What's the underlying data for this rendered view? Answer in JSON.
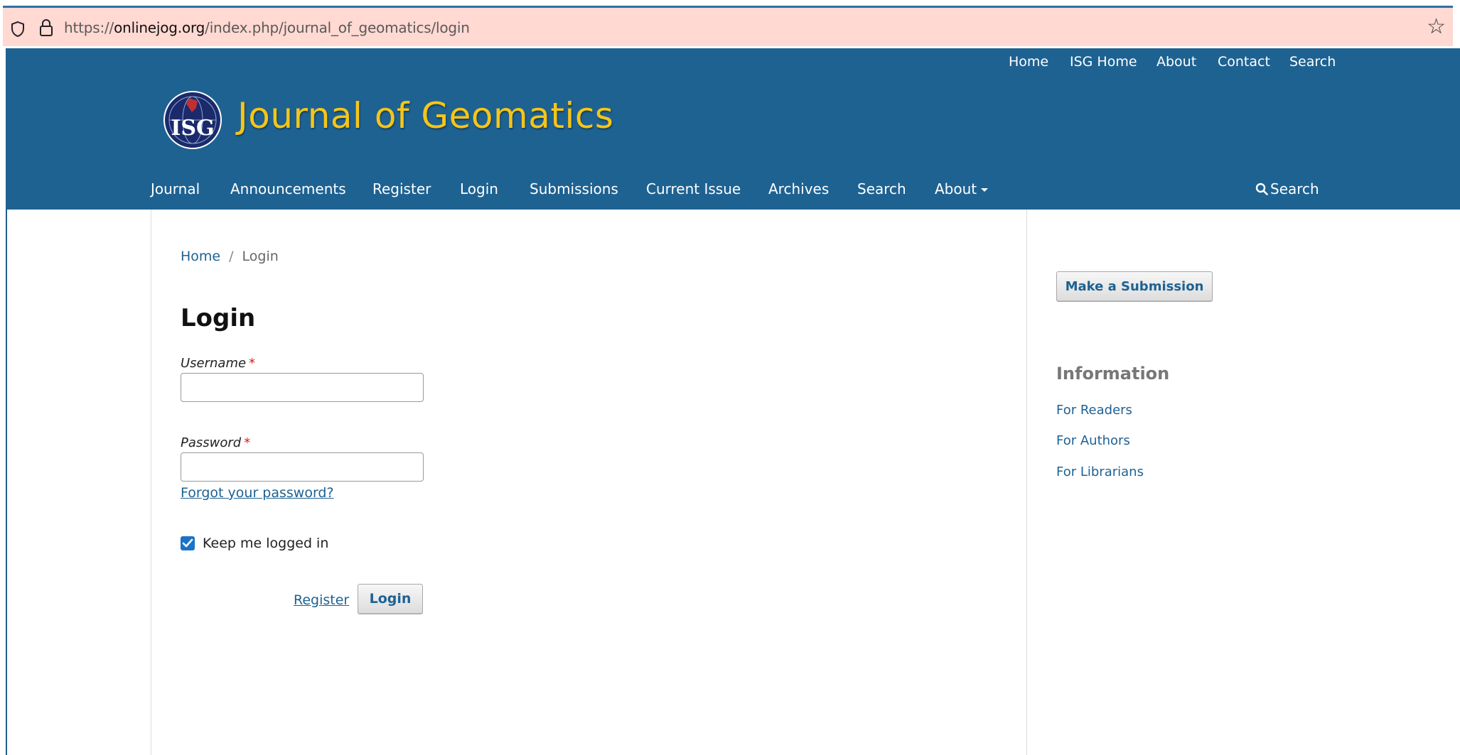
{
  "browser": {
    "url_prefix": "https://",
    "url_host": "onlinejog.org",
    "url_path": "/index.php/journal_of_geomatics/login"
  },
  "topnav": {
    "home": "Home",
    "isg_home": "ISG Home",
    "about": "About",
    "contact": "Contact",
    "search": "Search"
  },
  "site": {
    "title": "Journal of Geomatics",
    "logo_text": "ISG"
  },
  "mainnav": {
    "journal": "Journal",
    "announcements": "Announcements",
    "register": "Register",
    "login": "Login",
    "submissions": "Submissions",
    "current_issue": "Current Issue",
    "archives": "Archives",
    "search": "Search",
    "about": "About",
    "search_right": "Search"
  },
  "breadcrumb": {
    "home": "Home",
    "separator": "/",
    "current": "Login"
  },
  "form": {
    "title": "Login",
    "username_label": "Username",
    "password_label": "Password",
    "required_mark": "*",
    "username_value": "",
    "password_value": "",
    "forgot_password": "Forgot your password?",
    "keep_logged_in": "Keep me logged in",
    "keep_logged_in_checked": true,
    "register_link": "Register",
    "login_button": "Login"
  },
  "sidebar": {
    "submit_button": "Make a Submission",
    "info_title": "Information",
    "links": [
      "For Readers",
      "For Authors",
      "For Librarians"
    ]
  },
  "colors": {
    "header_bg": "#1e6292",
    "title_color": "#f5c518",
    "link_color": "#1e6292",
    "urlbar_bg": "#ffd9d2"
  }
}
